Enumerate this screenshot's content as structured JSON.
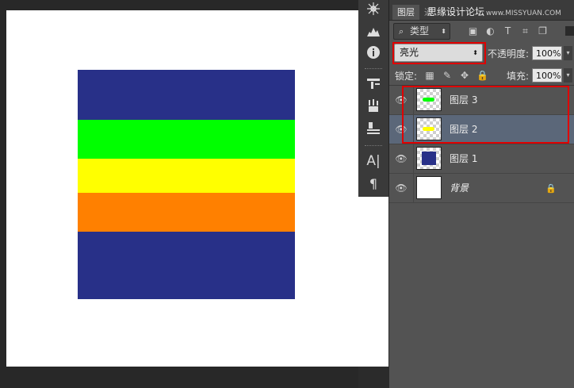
{
  "canvas": {
    "stripes": [
      {
        "name": "stripe-blue-top",
        "color": "#283088"
      },
      {
        "name": "stripe-green",
        "color": "#00ff00"
      },
      {
        "name": "stripe-yellow",
        "color": "#ffff00"
      },
      {
        "name": "stripe-orange",
        "color": "#ff8000"
      },
      {
        "name": "stripe-blue-bottom",
        "color": "#283088"
      }
    ]
  },
  "tools": [
    "navigator-icon",
    "histogram-icon",
    "info-icon",
    "brush-settings-icon",
    "tool-presets-icon",
    "clone-source-icon",
    "character-icon",
    "paragraph-icon"
  ],
  "panel": {
    "tab_layers": "图层",
    "tab_channels": "通",
    "watermark": "思缘设计论坛",
    "watermark_url": "www.MISSYUAN.COM",
    "filter": {
      "magnifier": "⌕",
      "label": "类型",
      "arrow": "⬍"
    },
    "filter_icons": {
      "image": "▣",
      "adjust": "◐",
      "text": "T",
      "shape": "⌗",
      "smart": "❐"
    },
    "blend_mode": "亮光",
    "blend_arrow": "⬍",
    "opacity_label": "不透明度:",
    "opacity_value": "100%",
    "lock_label": "锁定:",
    "fill_label": "填充:",
    "fill_value": "100%",
    "lock_icons": {
      "pixels": "▦",
      "paint": "✎",
      "move": "✥",
      "all": "🔒"
    },
    "dropdown_arrow": "▾",
    "eye_glyph": "👁",
    "lock_glyph": "🔒",
    "layers": [
      {
        "name": "图层 3",
        "selected": false,
        "mark_color": "#00ff00"
      },
      {
        "name": "图层 2",
        "selected": true,
        "mark_color": "#ffff00"
      },
      {
        "name": "图层 1",
        "selected": false,
        "mark_color": "#283088"
      },
      {
        "name": "背景",
        "selected": false,
        "mark_color": "#ffffff"
      }
    ]
  },
  "colors": {
    "highlight": "#e00000",
    "selection": "#5b6779",
    "panel_bg": "#535353"
  }
}
